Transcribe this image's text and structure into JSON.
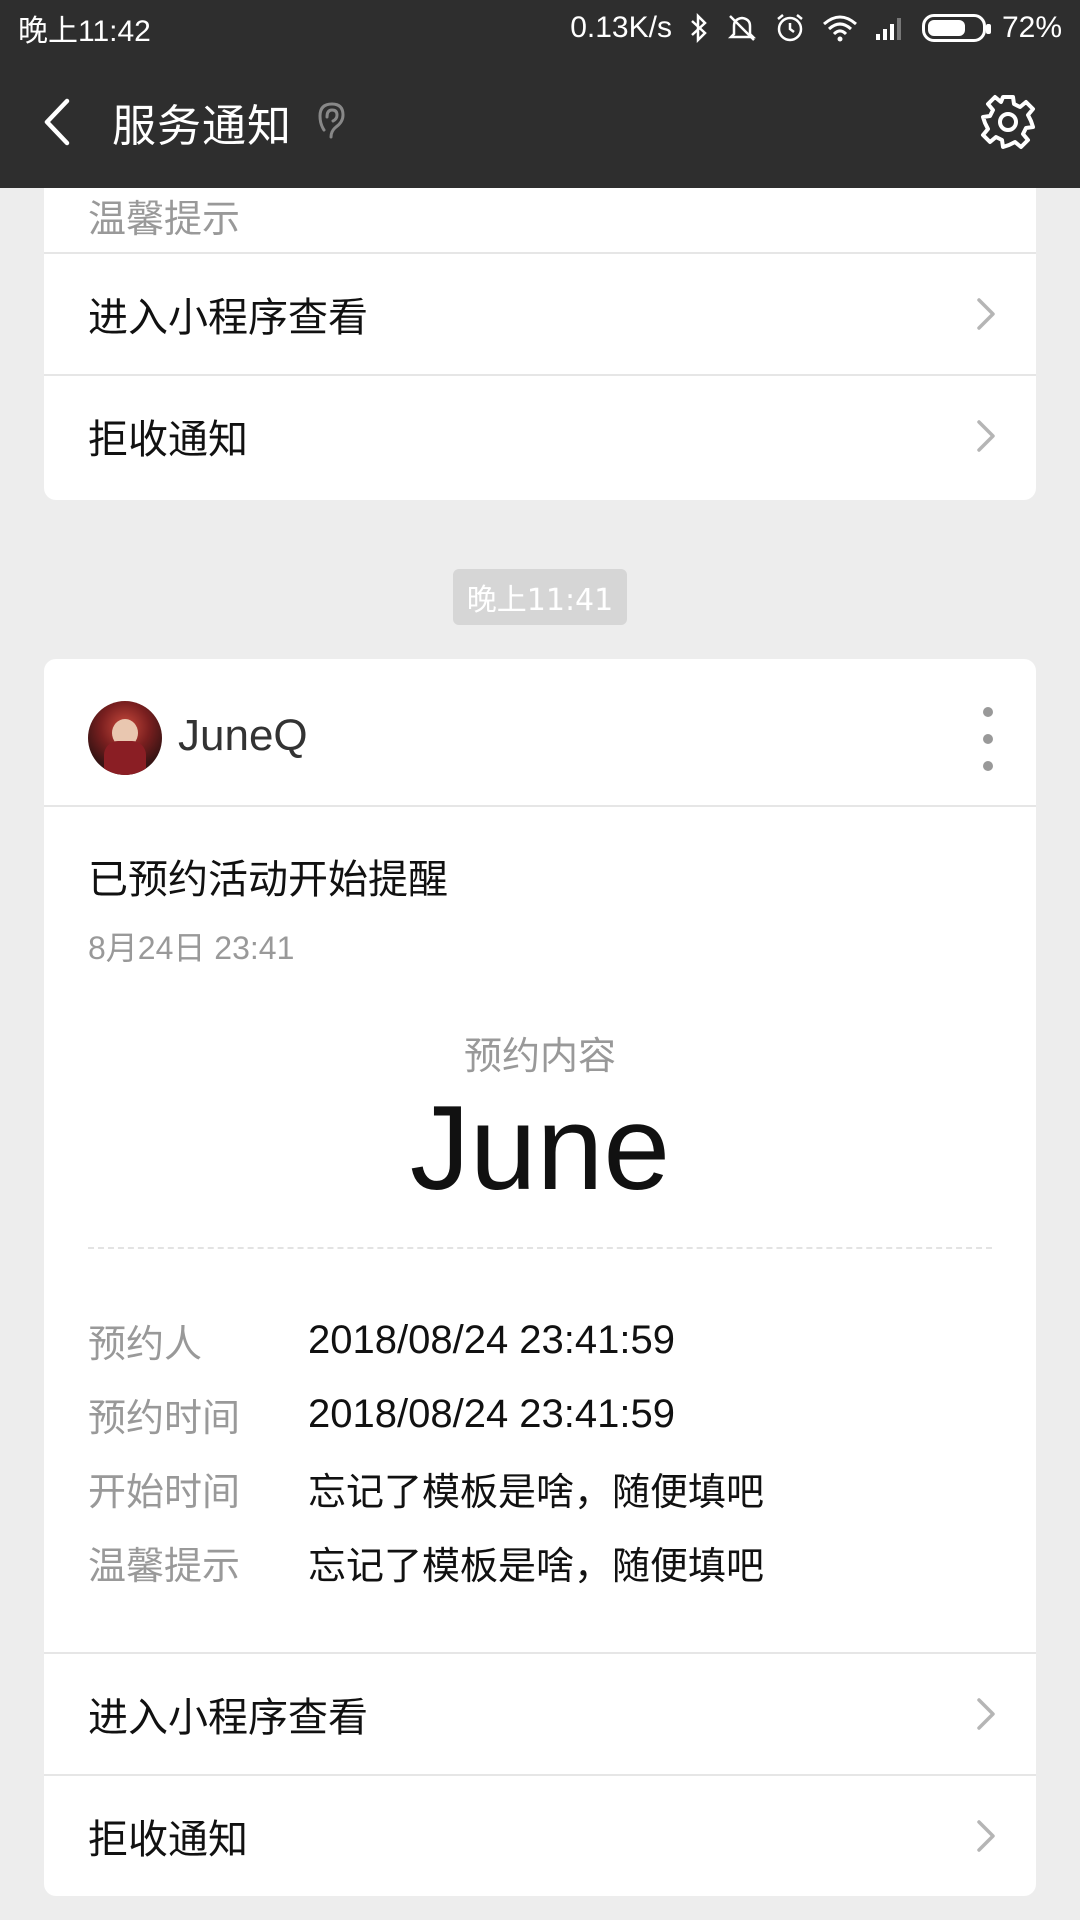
{
  "status_bar": {
    "time": "晚上11:42",
    "network_speed": "0.13K/s",
    "battery_percent": "72%",
    "battery_level": 0.72,
    "icons": [
      "bluetooth-icon",
      "mute-icon",
      "alarm-icon",
      "wifi-icon",
      "signal-icon",
      "battery-icon"
    ]
  },
  "header": {
    "title": "服务通知",
    "icons": [
      "back-arrow-icon",
      "ear-icon",
      "settings-gear-icon"
    ]
  },
  "previous_card": {
    "partial_text": "温馨提示",
    "links": [
      {
        "label": "进入小程序查看"
      },
      {
        "label": "拒收通知"
      }
    ]
  },
  "timestamp": "晚上11:41",
  "message_card": {
    "sender": "JuneQ",
    "title": "已预约活动开始提醒",
    "date": "8月24日  23:41",
    "key_label": "预约内容",
    "key_value": "June",
    "details": [
      {
        "key": "预约人",
        "value": "2018/08/24 23:41:59"
      },
      {
        "key": "预约时间",
        "value": "2018/08/24 23:41:59"
      },
      {
        "key": "开始时间",
        "value": "忘记了模板是啥，随便填吧"
      },
      {
        "key": "温馨提示",
        "value": "忘记了模板是啥，随便填吧"
      }
    ],
    "links": [
      {
        "label": "进入小程序查看"
      },
      {
        "label": "拒收通知"
      }
    ]
  },
  "colors": {
    "header_bg": "#2e2e2e",
    "page_bg": "#ededed",
    "card_bg": "#ffffff",
    "muted_text": "#999999",
    "timestamp_pill": "#d6d6d6"
  }
}
